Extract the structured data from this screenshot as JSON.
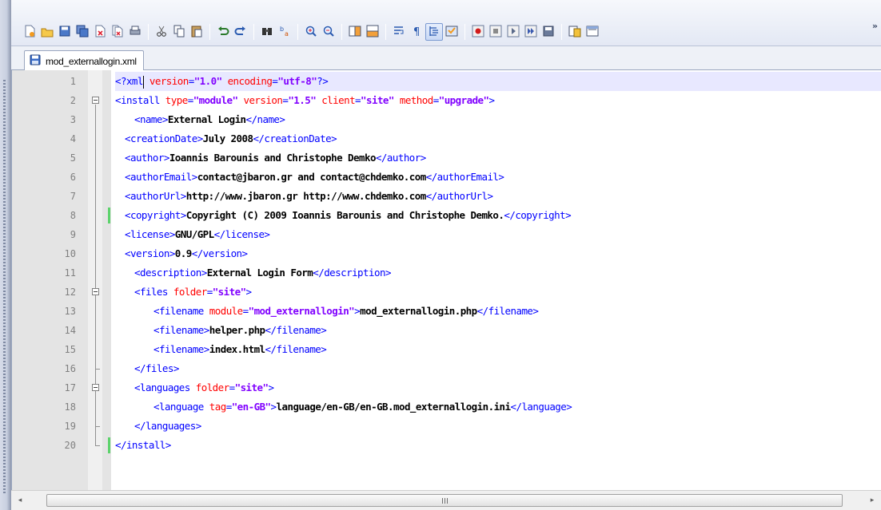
{
  "toolbar": {
    "more_label": "»",
    "buttons": [
      "new-file",
      "open-file",
      "save",
      "save-all",
      "close",
      "close-all",
      "print",
      "cut",
      "copy",
      "paste",
      "undo",
      "redo",
      "find",
      "replace",
      "zoom-in",
      "zoom-out",
      "sync-vertical",
      "sync-horizontal",
      "word-wrap",
      "show-all-characters",
      "indent-guide",
      "user-language",
      "record-macro",
      "stop-recording",
      "playback-macro",
      "run-macro-multiple",
      "save-macro",
      "document-map",
      "function-list"
    ],
    "pressed": [
      "indent-guide"
    ]
  },
  "tab": {
    "title": "mod_externallogin.xml"
  },
  "editor": {
    "current_line": 1,
    "lines": [
      {
        "n": "1",
        "t": "<?xml version=\"1.0\" encoding=\"utf-8\"?>"
      },
      {
        "n": "2",
        "t": "<install type=\"module\" version=\"1.5\" client=\"site\" method=\"upgrade\">"
      },
      {
        "n": "3",
        "t": "<name>External Login</name>"
      },
      {
        "n": "4",
        "t": "<creationDate>July 2008</creationDate>"
      },
      {
        "n": "5",
        "t": "<author>Ioannis Barounis and Christophe Demko</author>"
      },
      {
        "n": "6",
        "t": "<authorEmail>contact@jbaron.gr and contact@chdemko.com</authorEmail>"
      },
      {
        "n": "7",
        "t": "<authorUrl>http://www.jbaron.gr http://www.chdemko.com</authorUrl>"
      },
      {
        "n": "8",
        "t": "<copyright>Copyright (C) 2009 Ioannis Barounis and Christophe Demko.</copyright>"
      },
      {
        "n": "9",
        "t": "<license>GNU/GPL</license>"
      },
      {
        "n": "10",
        "t": "<version>0.9</version>"
      },
      {
        "n": "11",
        "t": "<description>External Login Form</description>"
      },
      {
        "n": "12",
        "t": "<files folder=\"site\">"
      },
      {
        "n": "13",
        "t": "<filename module=\"mod_externallogin\">mod_externallogin.php</filename>"
      },
      {
        "n": "14",
        "t": "<filename>helper.php</filename>"
      },
      {
        "n": "15",
        "t": "<filename>index.html</filename>"
      },
      {
        "n": "16",
        "t": "</files>"
      },
      {
        "n": "17",
        "t": "<languages folder=\"site\">"
      },
      {
        "n": "18",
        "t": "<language tag=\"en-GB\">language/en-GB/en-GB.mod_externallogin.ini</language>"
      },
      {
        "n": "19",
        "t": "</languages>"
      },
      {
        "n": "20",
        "t": "</install>"
      }
    ]
  },
  "scrollbar": {
    "left_arrow": "◂",
    "right_arrow": "▸"
  },
  "colors": {
    "tag": "#0000ff",
    "attribute": "#ff0000",
    "value": "#8000ff",
    "text": "#000000",
    "current_line": "#e8e8ff"
  }
}
